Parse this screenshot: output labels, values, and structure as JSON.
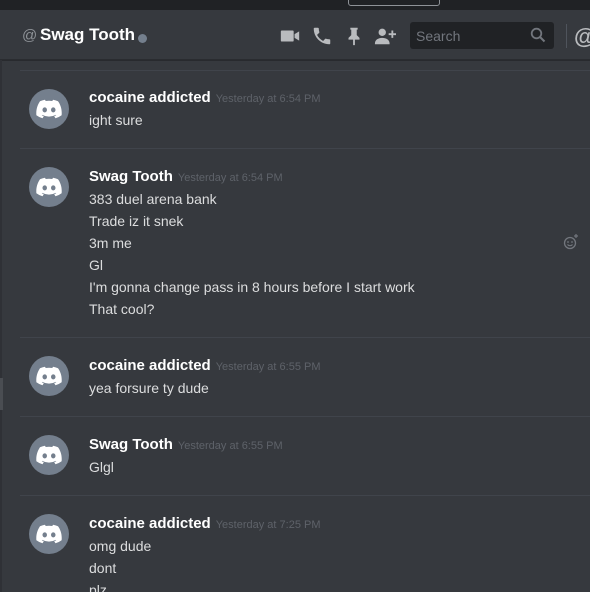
{
  "header": {
    "at_symbol": "@",
    "title": "Swag Tooth",
    "search_placeholder": "Search",
    "mention_symbol": "@"
  },
  "icons": {
    "video": "video-call-icon",
    "phone": "voice-call-icon",
    "pin": "pinned-messages-icon",
    "add_user": "add-friend-icon",
    "search": "search-icon",
    "emoji": "add-reaction-icon",
    "avatar": "discord-logo-icon"
  },
  "colors": {
    "background": "#36393e",
    "header_text": "#ffffff",
    "timestamp": "#5e6269",
    "avatar_bg": "#747f8d",
    "status_offline": "#747f8d"
  },
  "messages": [
    {
      "author": "cocaine addicted",
      "timestamp": "Yesterday at 6:54 PM",
      "lines": [
        "ight sure"
      ]
    },
    {
      "author": "Swag Tooth",
      "timestamp": "Yesterday at 6:54 PM",
      "lines": [
        "383 duel arena bank",
        "Trade iz it snek",
        "3m me",
        "Gl",
        "I'm gonna change pass in 8 hours before I start work",
        "That cool?"
      ]
    },
    {
      "author": "cocaine addicted",
      "timestamp": "Yesterday at 6:55 PM",
      "lines": [
        "yea forsure ty dude"
      ]
    },
    {
      "author": "Swag Tooth",
      "timestamp": "Yesterday at 6:55 PM",
      "lines": [
        "Glgl"
      ]
    },
    {
      "author": "cocaine addicted",
      "timestamp": "Yesterday at 7:25 PM",
      "lines": [
        "omg dude",
        "dont",
        "plz"
      ]
    }
  ]
}
